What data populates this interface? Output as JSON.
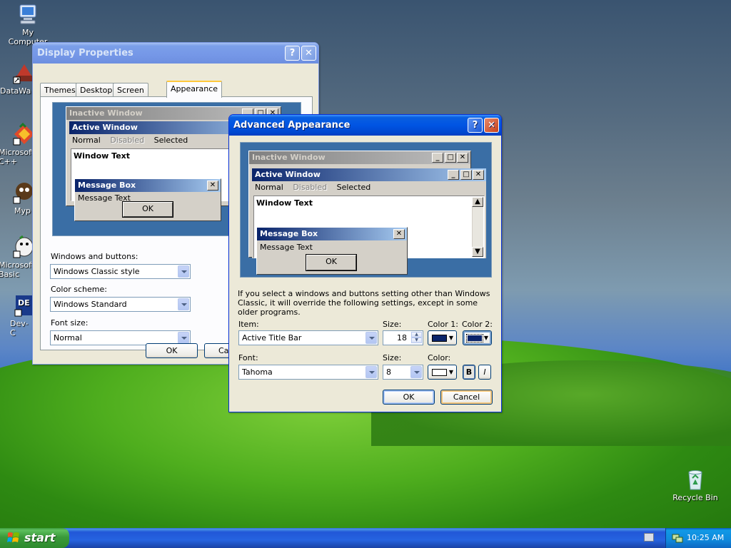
{
  "desktop": {
    "icons": [
      {
        "label": "My Computer"
      },
      {
        "label": "DataWa"
      },
      {
        "label": "Microsoft C++"
      },
      {
        "label": "Myp"
      },
      {
        "label": "Microsoft Basic"
      },
      {
        "label": "Dev-C"
      },
      {
        "label": "Recycle Bin"
      }
    ]
  },
  "display_props": {
    "title": "Display Properties",
    "tabs": [
      "Themes",
      "Desktop",
      "Screen Saver",
      "Appearance"
    ],
    "selected_tab": "Appearance",
    "preview": {
      "inactive_title": "Inactive Window",
      "active_title": "Active Window",
      "menu": [
        "Normal",
        "Disabled",
        "Selected"
      ],
      "window_text": "Window Text",
      "msgbox_title": "Message Box",
      "msgbox_text": "Message Text",
      "ok": "OK"
    },
    "windows_buttons_label": "Windows and buttons:",
    "windows_buttons_value": "Windows Classic style",
    "color_scheme_label": "Color scheme:",
    "color_scheme_value": "Windows Standard",
    "font_size_label": "Font size:",
    "font_size_value": "Normal",
    "ok": "OK",
    "cancel": "Ca"
  },
  "advanced": {
    "title": "Advanced Appearance",
    "preview": {
      "inactive_title": "Inactive Window",
      "active_title": "Active Window",
      "menu": [
        "Normal",
        "Disabled",
        "Selected"
      ],
      "window_text": "Window Text",
      "msgbox_title": "Message Box",
      "msgbox_text": "Message Text",
      "ok": "OK"
    },
    "description": "If you select a windows and buttons setting other than Windows Classic, it will override the following settings, except in some older programs.",
    "item_label": "Item:",
    "item_value": "Active Title Bar",
    "size_label": "Size:",
    "size_value": "18",
    "color1_label": "Color 1:",
    "color2_label": "Color 2:",
    "font_label": "Font:",
    "font_value": "Tahoma",
    "font_size_label": "Size:",
    "font_size_value": "8",
    "font_color_label": "Color:",
    "bold": "B",
    "italic": "I",
    "ok": "OK",
    "cancel": "Cancel",
    "colors": {
      "color1": "#0a246a",
      "color2": "#0a246a",
      "font_color": "#ffffff"
    }
  },
  "taskbar": {
    "start_label": "start",
    "clock": "10:25 AM"
  }
}
